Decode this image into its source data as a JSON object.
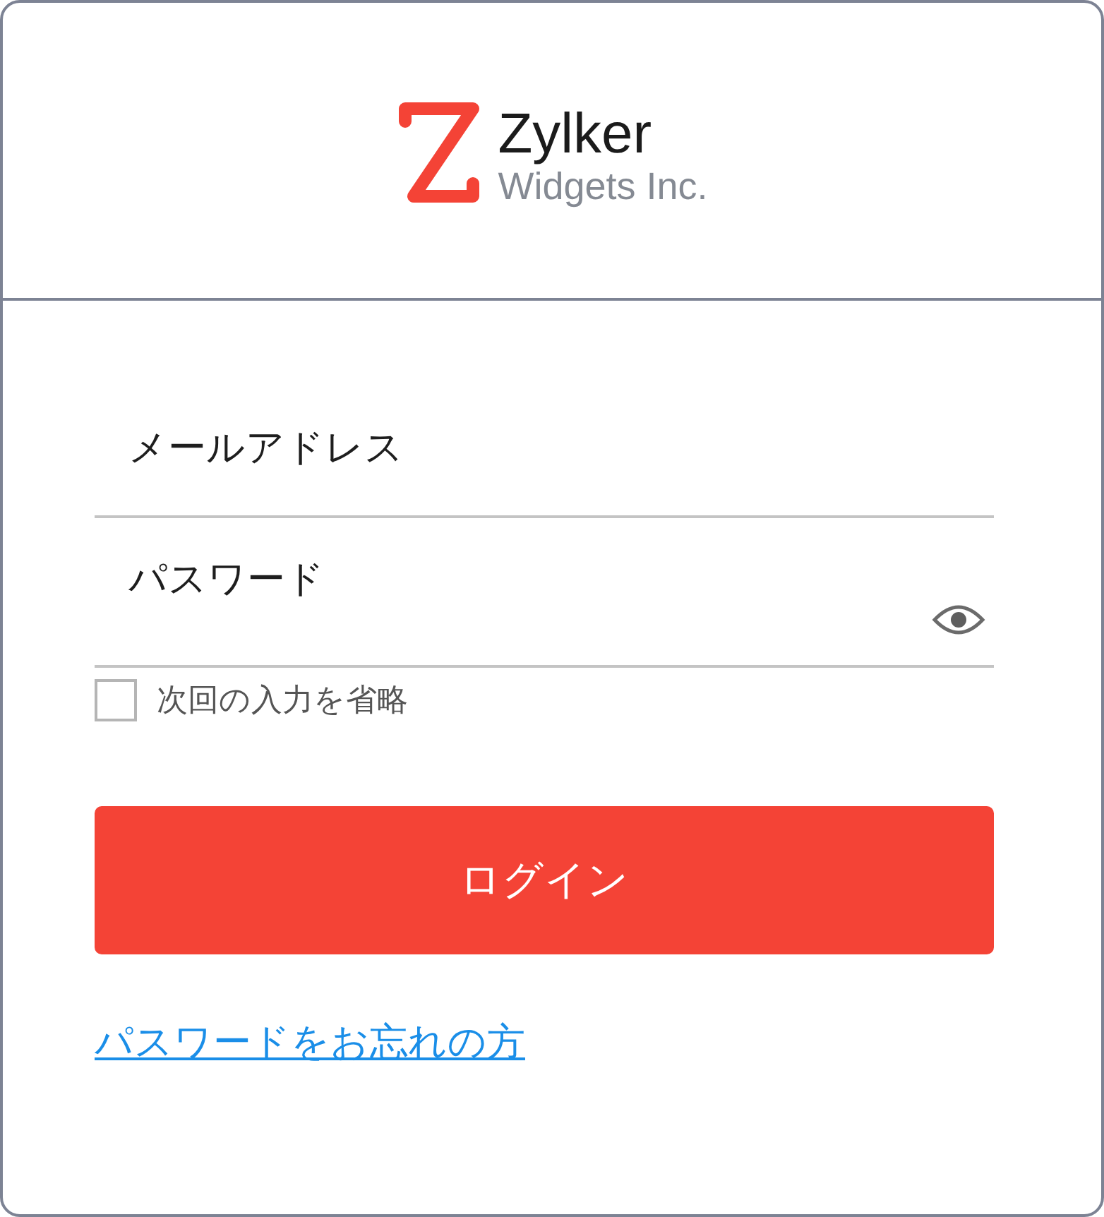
{
  "logo": {
    "name": "Zylker",
    "tagline": "Widgets Inc."
  },
  "fields": [
    {
      "kind": "email",
      "placeholder": "メールアドレス"
    },
    {
      "kind": "password",
      "placeholder": "パスワード"
    }
  ],
  "remember": {
    "label": "次回の入力を省略",
    "checked": false
  },
  "login_button": "ログイン",
  "forgot_link": "パスワードをお忘れの方"
}
